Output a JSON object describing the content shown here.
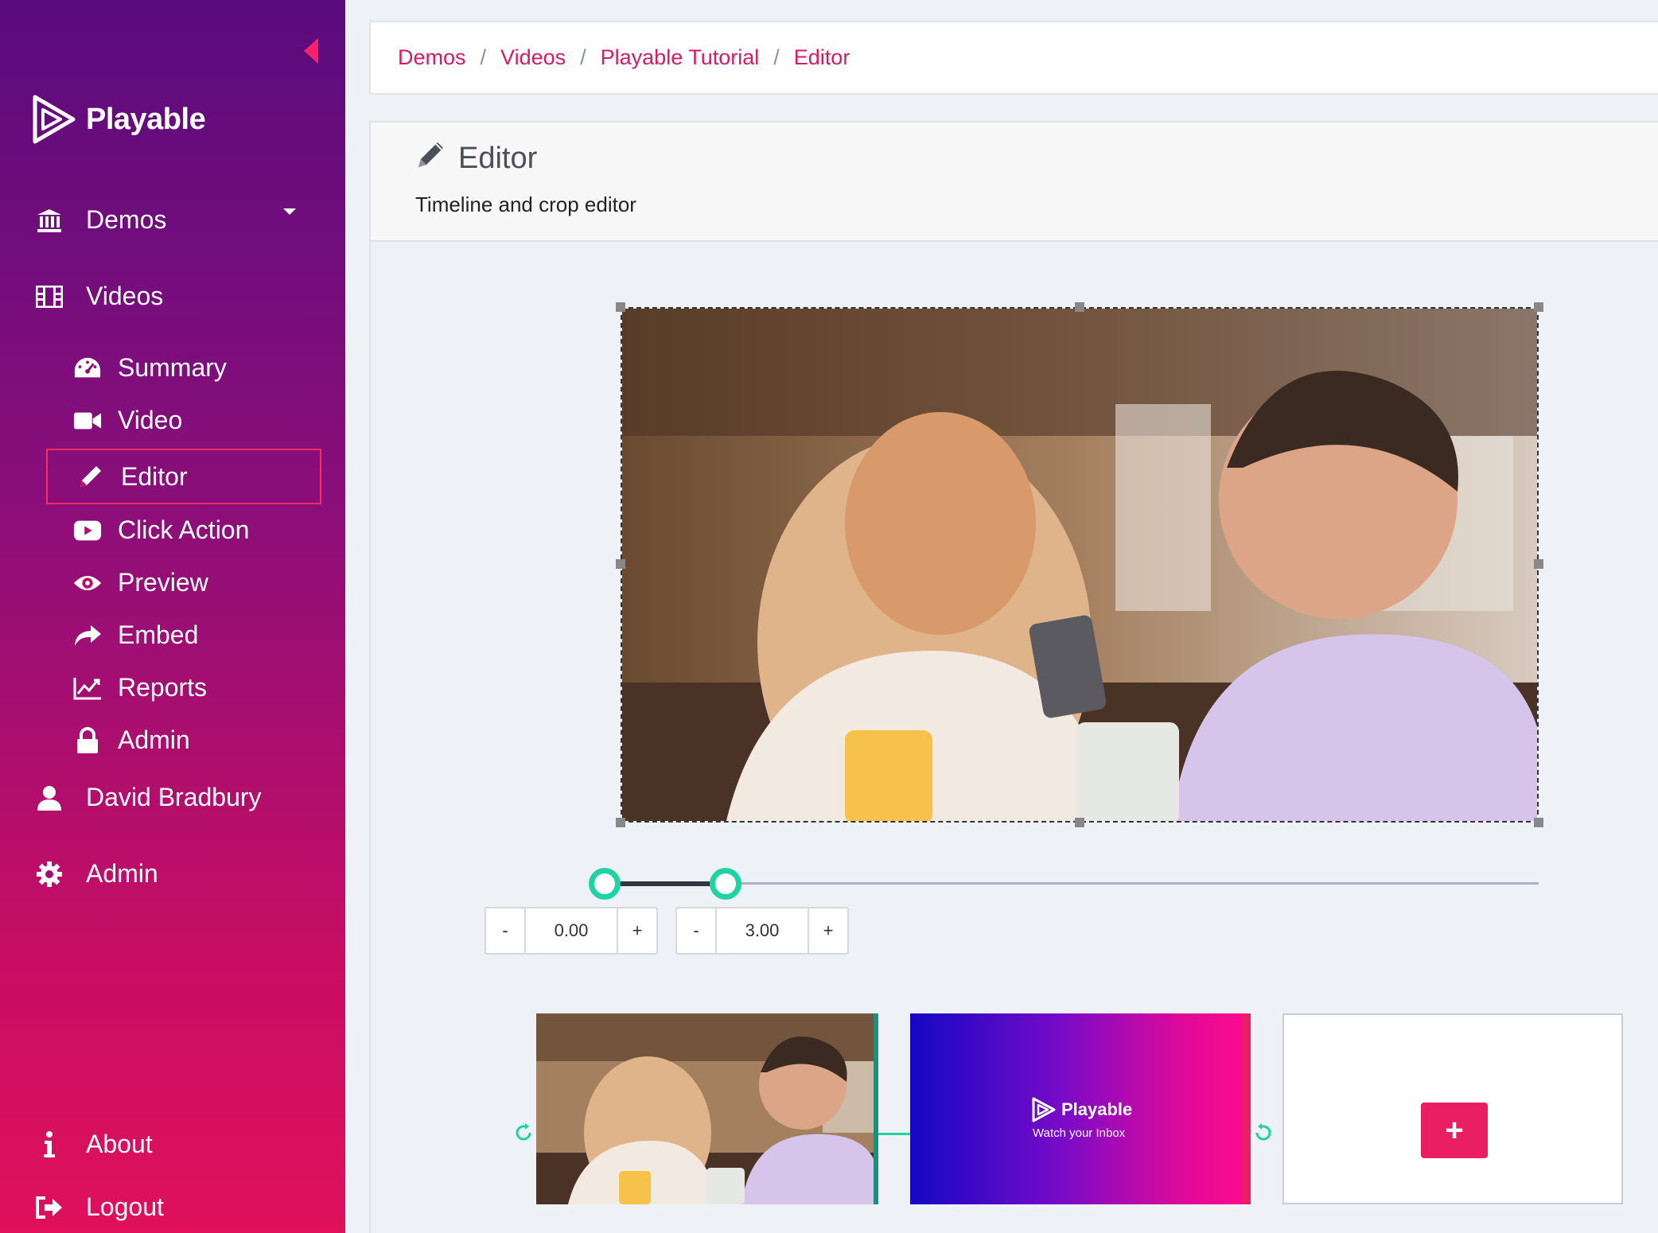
{
  "sidebar": {
    "brand": "Playable",
    "nav": [
      {
        "label": "Demos",
        "icon": "bank-icon"
      },
      {
        "label": "Videos",
        "icon": "film-icon"
      },
      {
        "label": "David Bradbury",
        "icon": "user-icon"
      },
      {
        "label": "Admin",
        "icon": "gear-icon"
      }
    ],
    "video_sub": [
      {
        "label": "Summary",
        "icon": "dashboard-icon"
      },
      {
        "label": "Video",
        "icon": "video-camera-icon"
      },
      {
        "label": "Editor",
        "icon": "pencil-icon",
        "active": true
      },
      {
        "label": "Click Action",
        "icon": "play-button-icon"
      },
      {
        "label": "Preview",
        "icon": "eye-icon"
      },
      {
        "label": "Embed",
        "icon": "share-icon"
      },
      {
        "label": "Reports",
        "icon": "chart-icon"
      },
      {
        "label": "Admin",
        "icon": "lock-icon"
      }
    ],
    "footer": [
      {
        "label": "About",
        "icon": "info-icon"
      },
      {
        "label": "Logout",
        "icon": "logout-icon"
      }
    ]
  },
  "breadcrumb": [
    "Demos",
    "Videos",
    "Playable Tutorial",
    "Editor"
  ],
  "panel": {
    "title": "Editor",
    "subtitle": "Timeline and crop editor"
  },
  "timeline": {
    "start": "0.00",
    "end": "3.00",
    "minus": "-",
    "plus": "+"
  },
  "clips": {
    "promo_brand": "Playable",
    "promo_tagline": "Watch your Inbox",
    "add_label": "+"
  },
  "colors": {
    "accent": "#e91e63",
    "knob": "#1ed4a4"
  }
}
